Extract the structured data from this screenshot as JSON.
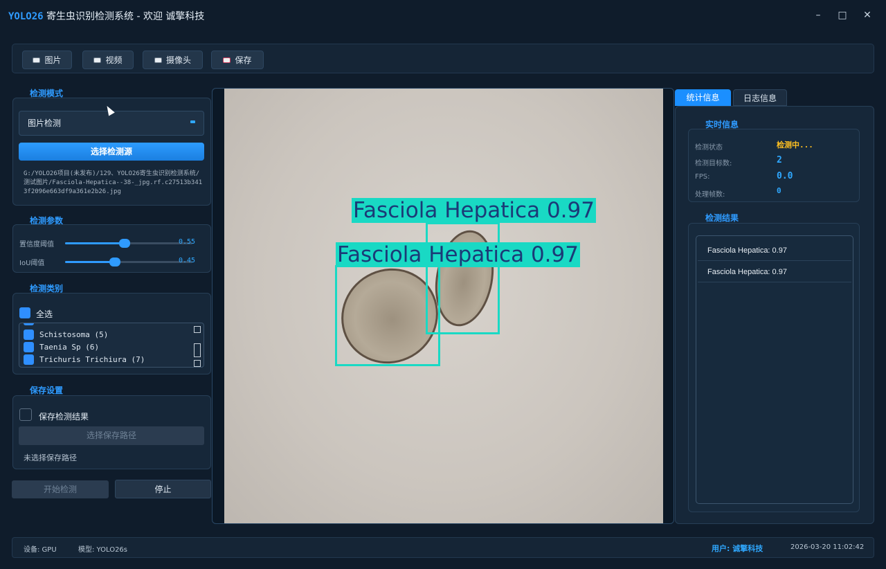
{
  "window": {
    "brand": "YOLO26",
    "title_rest": " 寄生虫识别检测系统 - 欢迎 诚擎科技",
    "controls": [
      "–",
      "□",
      "✕"
    ]
  },
  "toolbar": {
    "buttons": [
      {
        "label": "图片",
        "icon": "image-icon"
      },
      {
        "label": "视频",
        "icon": "video-icon"
      },
      {
        "label": "摄像头",
        "icon": "camera-icon"
      },
      {
        "label": "保存",
        "icon": "save-icon"
      }
    ]
  },
  "left": {
    "mode_title": "检测模式",
    "mode_value": "图片检测",
    "select_source_label": "选择检测源",
    "source_path": "G:/YOLO26项目(未发布)/129、YOLO26寄生虫识别检测系统/测试图片/Fasciola-Hepatica--38-_jpg.rf.c27513b3413f2096e663df9a361e2b26.jpg",
    "params_title": "检测参数",
    "params": [
      {
        "name": "置信度阈值",
        "value": "0.55",
        "level": 0.55
      },
      {
        "name": "IoU阈值",
        "value": "0.45",
        "level": 0.45
      }
    ],
    "classes_title": "检测类别",
    "select_all_label": "全选",
    "classes": [
      "Schistosoma (5)",
      "Taenia Sp (6)",
      "Trichuris Trichiura (7)"
    ],
    "save_title": "保存设置",
    "save_result_label": "保存检测结果",
    "choose_path_label": "选择保存路径",
    "path_status": "未选择保存路径",
    "start_label": "开始检测",
    "stop_label": "停止"
  },
  "detections": [
    {
      "label": "Fasciola Hepatica 0.97"
    },
    {
      "label": "Fasciola Hepatica 0.97"
    }
  ],
  "right": {
    "tabs": [
      "统计信息",
      "日志信息"
    ],
    "realtime_title": "实时信息",
    "stats": [
      {
        "key": "检测状态",
        "value": "检测中...",
        "color": "#ffc021"
      },
      {
        "key": "检测目标数:",
        "value": "2",
        "color": "#2fa8ff"
      },
      {
        "key": "FPS:",
        "value": "0.0",
        "color": "#2fa8ff"
      },
      {
        "key": "处理帧数:",
        "value": "0",
        "color": "#2fa8ff"
      }
    ],
    "results_title": "检测结果",
    "results": [
      "Fasciola Hepatica: 0.97",
      "Fasciola Hepatica: 0.97"
    ]
  },
  "status": {
    "device": "设备: GPU",
    "model": "模型: YOLO26s",
    "user": "用户: 诚擎科技",
    "datetime": "2026-03-20 11:02:42"
  },
  "colors": {
    "accent": "#2f9bff",
    "bbox": "#19d9c4",
    "warning": "#ffc021"
  }
}
